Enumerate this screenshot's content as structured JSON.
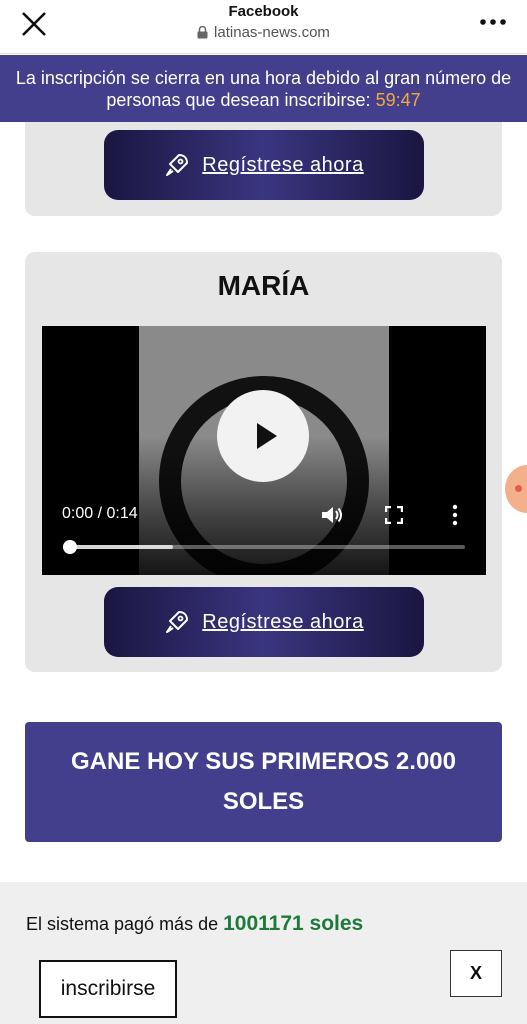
{
  "browser": {
    "title": "Facebook",
    "url": "latinas-news.com",
    "close_icon": "close-icon",
    "more_icon": "more-options-icon"
  },
  "banner": {
    "text": "La inscripción se cierra en una hora debido al gran número de personas que desean inscribirse:",
    "timer": "59:47"
  },
  "register_label": "Regístrese ahora",
  "profile": {
    "name": "MARÍA"
  },
  "video": {
    "time": "0:00 / 0:14",
    "progress_buffered": 0.26,
    "progress_played": 0
  },
  "cta": {
    "text": "GANE HOY SUS PRIMEROS 2.000 SOLES"
  },
  "bottom": {
    "paid_prefix": "El sistema pagó más de",
    "paid_amount": "1001171 soles",
    "subscribe_label": "inscribirse",
    "dismiss_label": "X"
  },
  "colors": {
    "banner_bg": "#443f8c",
    "timer": "#f2a93a",
    "amount": "#1e7a3a",
    "button_dark": "#1a1640"
  }
}
